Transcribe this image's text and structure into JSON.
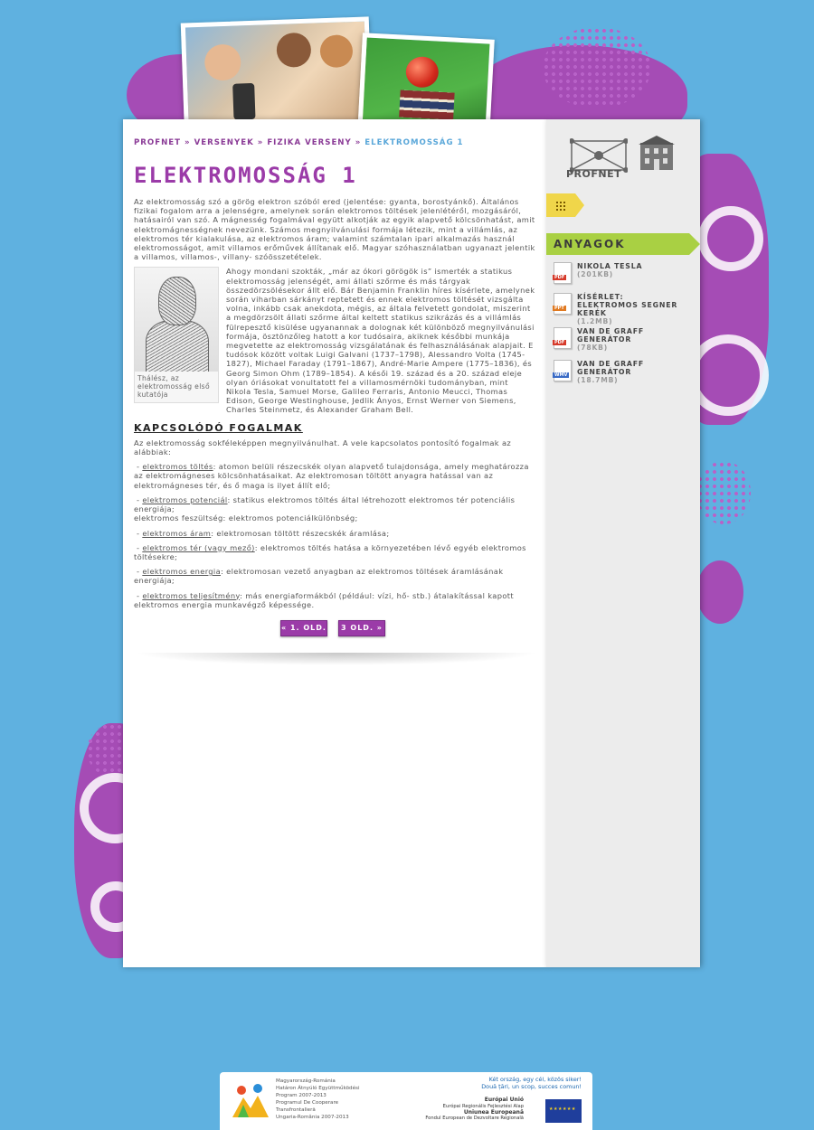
{
  "colors": {
    "background": "#5fb1e0",
    "accent": "#9b3ba8",
    "ribbon": "#a9d043",
    "link": "#5aa7d9"
  },
  "breadcrumb": {
    "items": [
      "PROFNET",
      "VERSENYEK",
      "FIZIKA VERSENY"
    ],
    "separator": "»",
    "current": "ELEKTROMOSSÁG 1"
  },
  "page": {
    "title": "ELEKTROMOSSÁG 1",
    "intro": "Az elektromosság szó a görög elektron szóból ered (jelentése: gyanta, borostyánkő). Általános fizikai fogalom arra a jelenségre, amelynek során elektromos töltések jelenlétéről, mozgásáról, hatásairól van szó. A mágnesség fogalmával együtt alkotják az egyik alapvető kölcsönhatást, amit elektromágnességnek nevezünk. Számos megnyilvánulási formája létezik, mint a villámlás, az elektromos tér kialakulása, az elektromos áram; valamint számtalan ipari alkalmazás használ elektromosságot, amit villamos erőművek állítanak elő. Magyar szóhasználatban ugyanazt jelentik a villamos, villamos-, villany- szóösszetételek.",
    "figure_caption": "Thálész, az elektromosság első kutatója",
    "history": "Ahogy mondani szokták, „már az ókori görögök is” ismerték a statikus elektromosság jelenségét, ami állati szőrme és más tárgyak összedörzsölésekor állt elő. Bár Benjamin Franklin híres kísérlete, amelynek során viharban sárkányt reptetett és ennek elektromos töltését vizsgálta volna, inkább csak anekdota, mégis, az általa felvetett gondolat, miszerint a megdörzsölt állati szőrme által keltett statikus szikrázás és a villámlás fülrepesztő kisülése ugyanannak a dolognak két különböző megnyilvánulási formája, ösztönzőleg hatott a kor tudósaira, akiknek későbbi munkája megvetette az elektromosság vizsgálatának és felhasználásának alapjait. E tudósok között voltak Luigi Galvani (1737–1798), Alessandro Volta (1745-1827), Michael Faraday (1791–1867), André-Marie Ampere (1775–1836), és Georg Simon Ohm (1789–1854). A késői 19. század és a 20. század eleje olyan óriásokat vonultatott fel a villamosmérnöki tudományban, mint Nikola Tesla, Samuel Morse, Galileo Ferraris, Antonio Meucci, Thomas Edison, George Westinghouse, Jedlik Ányos, Ernst Werner von Siemens, Charles Steinmetz, és Alexander Graham Bell.",
    "subheading": "KAPCSOLÓDÓ FOGALMAK",
    "related_intro": "Az elektromosság sokféleképpen megnyilvánulhat. A vele kapcsolatos pontosító fogalmak az alábbiak:",
    "terms": [
      {
        "term": "elektromos töltés",
        "text": ": atomon belüli részecskék olyan alapvető tulajdonsága, amely meghatározza az elektromágneses kölcsönhatásaikat. Az elektromosan töltött anyagra hatással van az elektromágneses tér, és ő maga is ilyet állít elő;"
      },
      {
        "term": "elektromos potenciál",
        "text": ": statikus elektromos töltés által létrehozott elektromos tér potenciális energiája;",
        "extra": "elektromos feszültség: elektromos potenciálkülönbség;"
      },
      {
        "term": "elektromos áram",
        "text": ": elektromosan töltött részecskék áramlása;"
      },
      {
        "term": "elektromos tér (vagy mező)",
        "text": ": elektromos töltés hatása a környezetében lévő egyéb elektromos töltésekre;"
      },
      {
        "term": "elektromos energia",
        "text": ": elektromosan vezető anyagban az elektromos töltések áramlásának energiája;"
      },
      {
        "term": "elektromos teljesítmény",
        "text": ": más energiaformákból (például: vízi, hő- stb.) átalakítással kapott elektromos energia munkavégző képessége."
      }
    ],
    "prev_label": "« 1. OLD.",
    "next_label": "3 OLD. »"
  },
  "sidebar": {
    "logo_text": "PROFNET",
    "section_title": "ANYAGOK",
    "downloads": [
      {
        "name": "NIKOLA TESLA",
        "size": "(201KB)",
        "type": "PDF",
        "icon": "pdf-file-icon"
      },
      {
        "name": "KÍSÉRLET: ELEKTROMOS SEGNER KERÉK",
        "size": "(1.2MB)",
        "type": "PPT",
        "icon": "ppt-file-icon"
      },
      {
        "name": "VAN DE GRAFF GENERÁTOR",
        "size": "(78KB)",
        "type": "PDF",
        "icon": "pdf-file-icon"
      },
      {
        "name": "VAN DE GRAFF GENERÁTOR",
        "size": "(18.7MB)",
        "type": "WMV",
        "icon": "video-file-icon"
      }
    ]
  },
  "footer": {
    "left_lines": [
      "Magyarország-Románia",
      "Határon Átnyúló Együttműködési",
      "Program 2007-2013",
      "Programul De Cooperare",
      "Transfrontalieră",
      "Ungaria-România 2007-2013"
    ],
    "right_lines": [
      "Két ország, egy cél, közös siker!",
      "Două țări, un scop, succes comun!"
    ],
    "eu_lines": [
      "Európai Unió",
      "Európai Regionális Fejlesztési Alap",
      "Uniunea Europeană",
      "Fondul European de Dezvoltare Regională"
    ]
  }
}
